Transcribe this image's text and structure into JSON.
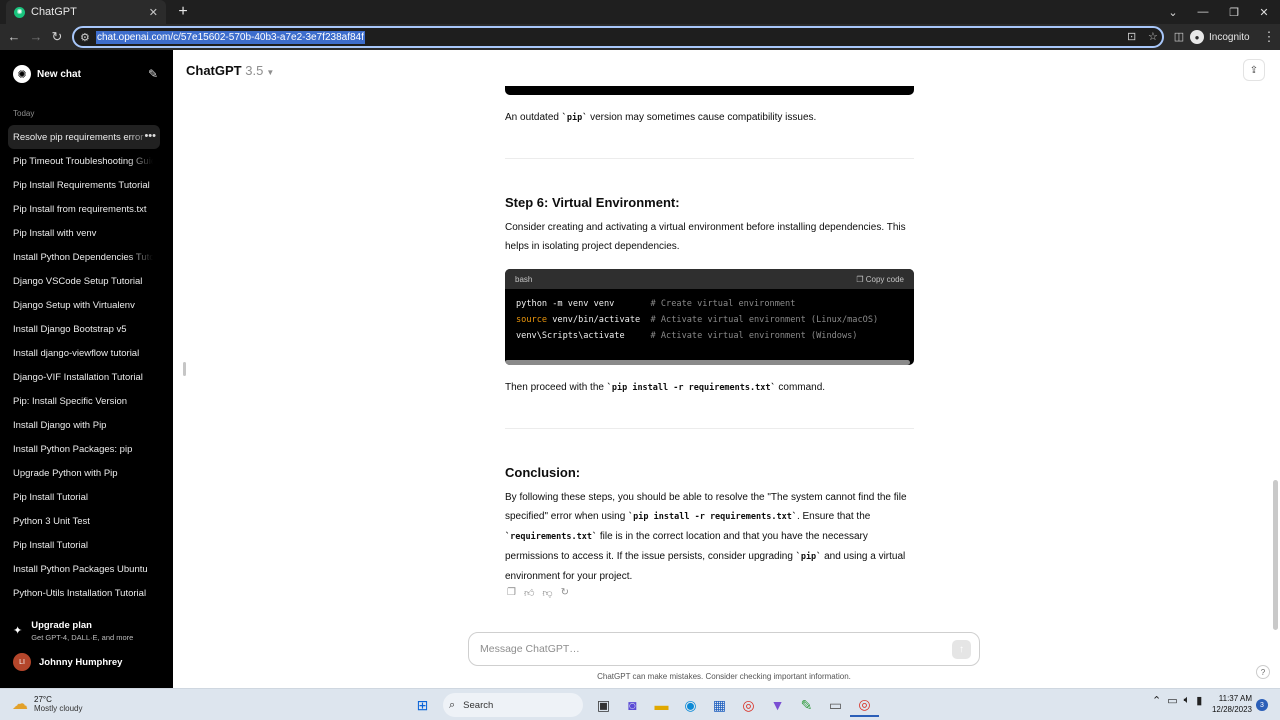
{
  "browser": {
    "tab_title": "ChatGPT",
    "url": "chat.openai.com/c/57e15602-570b-40b3-a7e2-3e7f238af84f",
    "incognito_label": "Incognito"
  },
  "sidebar": {
    "new_chat_label": "New chat",
    "section_label": "Today",
    "items": [
      {
        "label": "Resolve pip requirements error"
      },
      {
        "label": "Pip Timeout Troubleshooting Guide"
      },
      {
        "label": "Pip Install Requirements Tutorial"
      },
      {
        "label": "Pip Install from requirements.txt"
      },
      {
        "label": "Pip Install with venv"
      },
      {
        "label": "Install Python Dependencies Tutorial"
      },
      {
        "label": "Django VSCode Setup Tutorial"
      },
      {
        "label": "Django Setup with Virtualenv"
      },
      {
        "label": "Install Django Bootstrap v5"
      },
      {
        "label": "Install django-viewflow tutorial"
      },
      {
        "label": "Django-VIF Installation Tutorial"
      },
      {
        "label": "Pip: Install Specific Version"
      },
      {
        "label": "Install Django with Pip"
      },
      {
        "label": "Install Python Packages: pip"
      },
      {
        "label": "Upgrade Python with Pip"
      },
      {
        "label": "Pip Install Tutorial"
      },
      {
        "label": "Python 3 Unit Test"
      },
      {
        "label": "Pip Install Tutorial"
      },
      {
        "label": "Install Python Packages Ubuntu"
      },
      {
        "label": "Python-Utils Installation Tutorial"
      }
    ],
    "upgrade_title": "Upgrade plan",
    "upgrade_sub": "Get GPT-4, DALL·E, and more",
    "user_initials": "LI",
    "user_name": "Johnny Humphrey"
  },
  "header": {
    "model_name": "ChatGPT",
    "model_version": "3.5"
  },
  "message": {
    "p1_before": "An outdated ",
    "p1_code": "`pip`",
    "p1_after": " version may sometimes cause compatibility issues.",
    "step6_title": "Step 6: Virtual Environment:",
    "step6_text": "Consider creating and activating a virtual environment before installing dependencies. This helps in isolating project dependencies.",
    "code_lang": "bash",
    "copy_label": "Copy code",
    "code_lines": [
      {
        "kw": "",
        "cmd": "python -m venv venv       ",
        "comment": "# Create virtual environment"
      },
      {
        "kw": "source",
        "cmd": " venv/bin/activate  ",
        "comment": "# Activate virtual environment (Linux/macOS)"
      },
      {
        "kw": "",
        "cmd": "venv\\Scripts\\activate     ",
        "comment": "# Activate virtual environment (Windows)"
      }
    ],
    "then_before": "Then proceed with the ",
    "then_code": "`pip install -r requirements.txt`",
    "then_after": " command.",
    "conclusion_title": "Conclusion:",
    "c_1": "By following these steps, you should be able to resolve the \"The system cannot find the file specified\" error when using ",
    "c_code1": "`pip install -r requirements.txt`",
    "c_2": ". Ensure that the ",
    "c_code2": "`requirements.txt`",
    "c_3": " file is in the correct location and that you have the necessary permissions to access it. If the issue persists, consider upgrading ",
    "c_code3": "`pip`",
    "c_4": " and using a virtual environment for your project."
  },
  "composer": {
    "placeholder": "Message ChatGPT…",
    "disclaimer": "ChatGPT can make mistakes. Consider checking important information."
  },
  "taskbar": {
    "temperature": "27°C",
    "condition": "Mostly cloudy",
    "search_label": "Search",
    "time": "11:37 AM",
    "date": "12/28/2023",
    "notification_count": "3"
  }
}
